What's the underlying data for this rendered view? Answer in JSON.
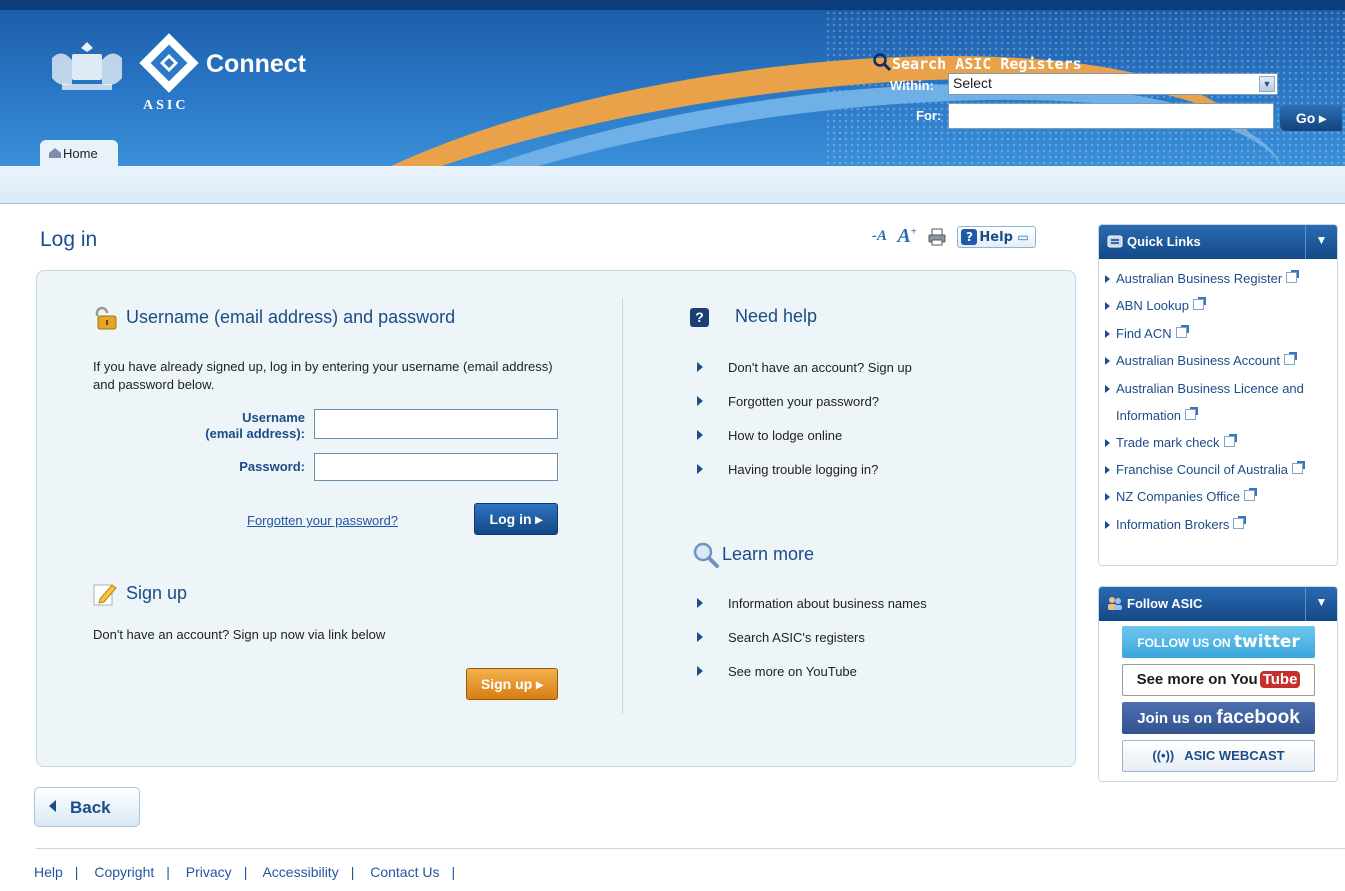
{
  "header": {
    "brand": "Connect",
    "org": "ASIC",
    "tab_home": "Home",
    "search": {
      "title": "Search ASIC Registers",
      "within_label": "Within:",
      "within_value": "Select",
      "for_label": "For:",
      "for_value": "",
      "go_label": "Go"
    }
  },
  "page": {
    "title": "Log in",
    "tools": {
      "text_smaller": "A",
      "text_larger": "A",
      "help_label": "Help"
    }
  },
  "login": {
    "heading": "Username (email address) and password",
    "intro": "If you have already signed up, log in by entering your username (email address) and password below.",
    "username_label_1": "Username",
    "username_label_2": "(email address):",
    "username_value": "",
    "password_label": "Password:",
    "password_value": "",
    "forgot_link": "Forgotten your password?",
    "login_button": "Log in"
  },
  "signup": {
    "heading": "Sign up",
    "text": "Don't have an account? Sign up now via link below",
    "button": "Sign up"
  },
  "need_help": {
    "heading": "Need help",
    "items": [
      "Don't have an account? Sign up",
      "Forgotten your password?",
      "How to lodge online",
      "Having trouble logging in?"
    ]
  },
  "learn_more": {
    "heading": "Learn more",
    "items": [
      "Information about business names",
      "Search ASIC's registers",
      "See more on YouTube"
    ]
  },
  "quick_links": {
    "title": "Quick Links",
    "items": [
      "Australian Business Register",
      "ABN Lookup",
      "Find ACN",
      "Australian Business Account",
      "Australian Business Licence and Information",
      "Trade mark check",
      "Franchise Council of Australia",
      "NZ Companies Office",
      "Information Brokers"
    ]
  },
  "follow": {
    "title": "Follow ASIC",
    "twitter_pre": "FOLLOW US ON",
    "twitter_brand": "twitter",
    "youtube_pre": "See more on",
    "youtube_you": "You",
    "youtube_tube": "Tube",
    "facebook_pre": "Join us on",
    "facebook_brand": "facebook",
    "webcast": "ASIC WEBCAST"
  },
  "back_label": "Back",
  "footer": [
    "Help",
    "Copyright",
    "Privacy",
    "Accessibility",
    "Contact Us"
  ],
  "colors": {
    "brand_blue": "#1d5ea9",
    "accent_orange": "#e9a14a",
    "link_blue": "#2356a2"
  }
}
